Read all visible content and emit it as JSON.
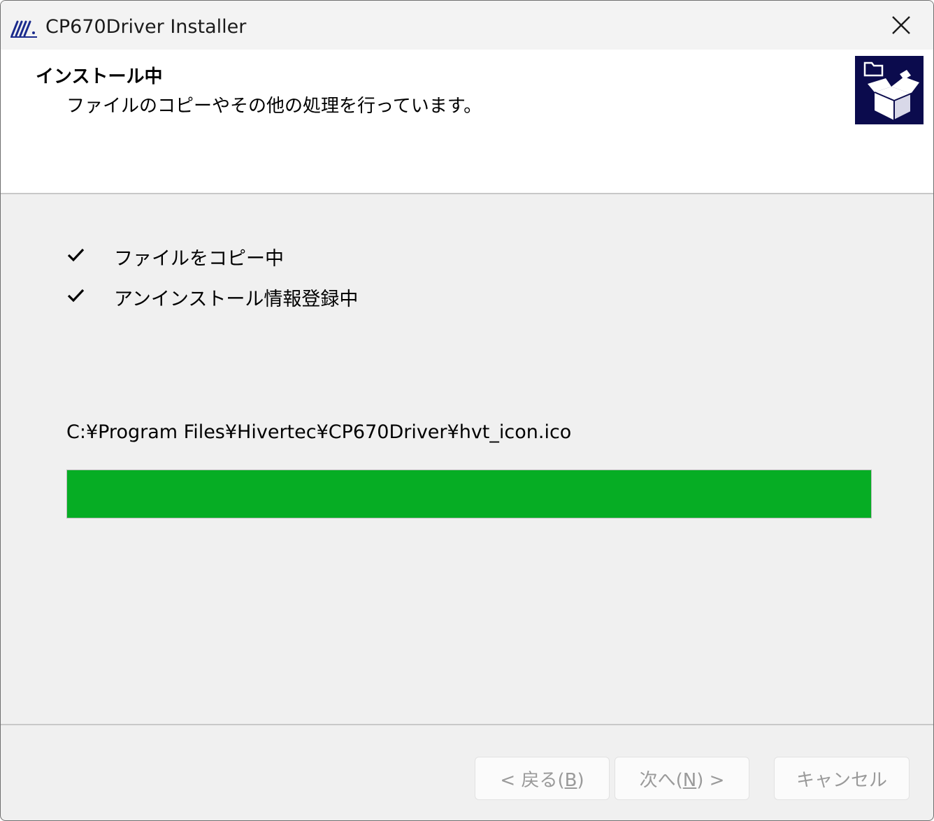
{
  "window": {
    "title": "CP670Driver Installer"
  },
  "header": {
    "title": "インストール中",
    "subtitle": "ファイルのコピーやその他の処理を行っています。",
    "icon": "package-icon"
  },
  "steps": [
    {
      "label": "ファイルをコピー中",
      "done": true
    },
    {
      "label": "アンインストール情報登録中",
      "done": true
    }
  ],
  "current_file": "C:¥Program Files¥Hivertec¥CP670Driver¥hvt_icon.ico",
  "progress": {
    "percent": 100,
    "color": "#06ad24"
  },
  "buttons": {
    "back": {
      "pre": "< 戻る(",
      "key": "B",
      "post": ")",
      "enabled": false
    },
    "next": {
      "pre": "次へ(",
      "key": "N",
      "post": ") >",
      "enabled": false
    },
    "cancel": {
      "label": "キャンセル",
      "enabled": false
    }
  }
}
